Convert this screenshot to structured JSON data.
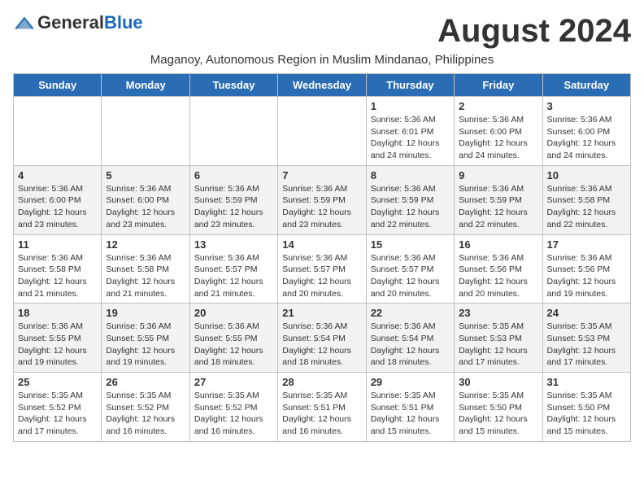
{
  "logo": {
    "general": "General",
    "blue": "Blue"
  },
  "month_title": "August 2024",
  "subtitle": "Maganoy, Autonomous Region in Muslim Mindanao, Philippines",
  "headers": [
    "Sunday",
    "Monday",
    "Tuesday",
    "Wednesday",
    "Thursday",
    "Friday",
    "Saturday"
  ],
  "weeks": [
    [
      {
        "day": "",
        "info": ""
      },
      {
        "day": "",
        "info": ""
      },
      {
        "day": "",
        "info": ""
      },
      {
        "day": "",
        "info": ""
      },
      {
        "day": "1",
        "info": "Sunrise: 5:36 AM\nSunset: 6:01 PM\nDaylight: 12 hours\nand 24 minutes."
      },
      {
        "day": "2",
        "info": "Sunrise: 5:36 AM\nSunset: 6:00 PM\nDaylight: 12 hours\nand 24 minutes."
      },
      {
        "day": "3",
        "info": "Sunrise: 5:36 AM\nSunset: 6:00 PM\nDaylight: 12 hours\nand 24 minutes."
      }
    ],
    [
      {
        "day": "4",
        "info": "Sunrise: 5:36 AM\nSunset: 6:00 PM\nDaylight: 12 hours\nand 23 minutes."
      },
      {
        "day": "5",
        "info": "Sunrise: 5:36 AM\nSunset: 6:00 PM\nDaylight: 12 hours\nand 23 minutes."
      },
      {
        "day": "6",
        "info": "Sunrise: 5:36 AM\nSunset: 5:59 PM\nDaylight: 12 hours\nand 23 minutes."
      },
      {
        "day": "7",
        "info": "Sunrise: 5:36 AM\nSunset: 5:59 PM\nDaylight: 12 hours\nand 23 minutes."
      },
      {
        "day": "8",
        "info": "Sunrise: 5:36 AM\nSunset: 5:59 PM\nDaylight: 12 hours\nand 22 minutes."
      },
      {
        "day": "9",
        "info": "Sunrise: 5:36 AM\nSunset: 5:59 PM\nDaylight: 12 hours\nand 22 minutes."
      },
      {
        "day": "10",
        "info": "Sunrise: 5:36 AM\nSunset: 5:58 PM\nDaylight: 12 hours\nand 22 minutes."
      }
    ],
    [
      {
        "day": "11",
        "info": "Sunrise: 5:36 AM\nSunset: 5:58 PM\nDaylight: 12 hours\nand 21 minutes."
      },
      {
        "day": "12",
        "info": "Sunrise: 5:36 AM\nSunset: 5:58 PM\nDaylight: 12 hours\nand 21 minutes."
      },
      {
        "day": "13",
        "info": "Sunrise: 5:36 AM\nSunset: 5:57 PM\nDaylight: 12 hours\nand 21 minutes."
      },
      {
        "day": "14",
        "info": "Sunrise: 5:36 AM\nSunset: 5:57 PM\nDaylight: 12 hours\nand 20 minutes."
      },
      {
        "day": "15",
        "info": "Sunrise: 5:36 AM\nSunset: 5:57 PM\nDaylight: 12 hours\nand 20 minutes."
      },
      {
        "day": "16",
        "info": "Sunrise: 5:36 AM\nSunset: 5:56 PM\nDaylight: 12 hours\nand 20 minutes."
      },
      {
        "day": "17",
        "info": "Sunrise: 5:36 AM\nSunset: 5:56 PM\nDaylight: 12 hours\nand 19 minutes."
      }
    ],
    [
      {
        "day": "18",
        "info": "Sunrise: 5:36 AM\nSunset: 5:55 PM\nDaylight: 12 hours\nand 19 minutes."
      },
      {
        "day": "19",
        "info": "Sunrise: 5:36 AM\nSunset: 5:55 PM\nDaylight: 12 hours\nand 19 minutes."
      },
      {
        "day": "20",
        "info": "Sunrise: 5:36 AM\nSunset: 5:55 PM\nDaylight: 12 hours\nand 18 minutes."
      },
      {
        "day": "21",
        "info": "Sunrise: 5:36 AM\nSunset: 5:54 PM\nDaylight: 12 hours\nand 18 minutes."
      },
      {
        "day": "22",
        "info": "Sunrise: 5:36 AM\nSunset: 5:54 PM\nDaylight: 12 hours\nand 18 minutes."
      },
      {
        "day": "23",
        "info": "Sunrise: 5:35 AM\nSunset: 5:53 PM\nDaylight: 12 hours\nand 17 minutes."
      },
      {
        "day": "24",
        "info": "Sunrise: 5:35 AM\nSunset: 5:53 PM\nDaylight: 12 hours\nand 17 minutes."
      }
    ],
    [
      {
        "day": "25",
        "info": "Sunrise: 5:35 AM\nSunset: 5:52 PM\nDaylight: 12 hours\nand 17 minutes."
      },
      {
        "day": "26",
        "info": "Sunrise: 5:35 AM\nSunset: 5:52 PM\nDaylight: 12 hours\nand 16 minutes."
      },
      {
        "day": "27",
        "info": "Sunrise: 5:35 AM\nSunset: 5:52 PM\nDaylight: 12 hours\nand 16 minutes."
      },
      {
        "day": "28",
        "info": "Sunrise: 5:35 AM\nSunset: 5:51 PM\nDaylight: 12 hours\nand 16 minutes."
      },
      {
        "day": "29",
        "info": "Sunrise: 5:35 AM\nSunset: 5:51 PM\nDaylight: 12 hours\nand 15 minutes."
      },
      {
        "day": "30",
        "info": "Sunrise: 5:35 AM\nSunset: 5:50 PM\nDaylight: 12 hours\nand 15 minutes."
      },
      {
        "day": "31",
        "info": "Sunrise: 5:35 AM\nSunset: 5:50 PM\nDaylight: 12 hours\nand 15 minutes."
      }
    ]
  ]
}
